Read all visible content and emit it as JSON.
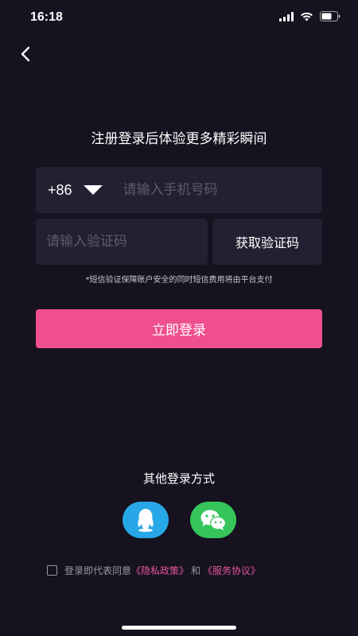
{
  "status": {
    "time": "16:18"
  },
  "headline": "注册登录后体验更多精彩瞬间",
  "phone": {
    "country_code": "+86",
    "placeholder": "请输入手机号码"
  },
  "code": {
    "placeholder": "请输入验证码",
    "get_code_label": "获取验证码"
  },
  "notice": "*短信验证保障账户安全的同时短信费用将由平台支付",
  "login_label": "立即登录",
  "other_login": {
    "title": "其他登录方式"
  },
  "agreement": {
    "prefix": "登录即代表同意",
    "privacy": "《隐私政策》",
    "and": "和",
    "service": "《服务协议》"
  },
  "colors": {
    "background": "#16121f",
    "field": "#241f31",
    "accent": "#ef4f8f",
    "qq": "#27a7e7",
    "wechat": "#35c55b"
  }
}
